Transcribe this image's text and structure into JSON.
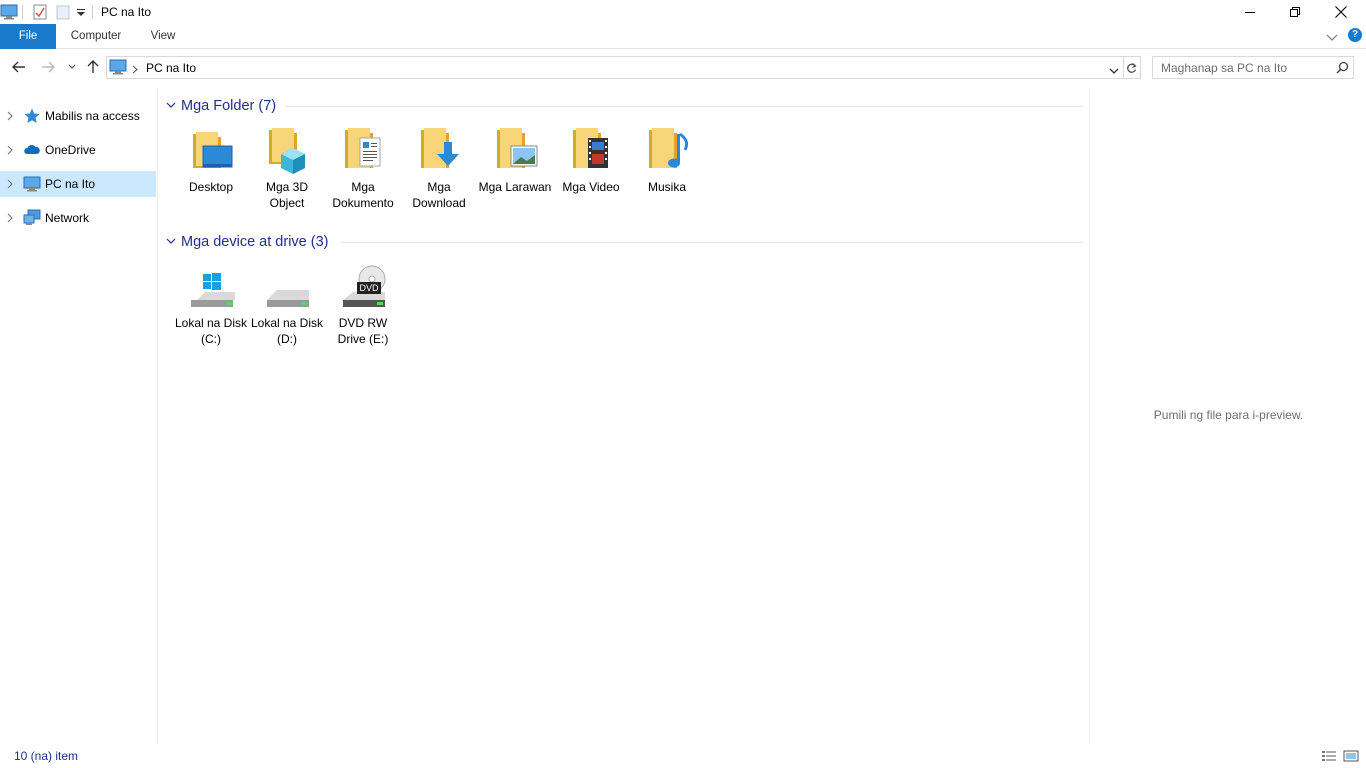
{
  "window": {
    "title": "PC na Ito"
  },
  "ribbon": {
    "tabs": [
      {
        "label": "File"
      },
      {
        "label": "Computer"
      },
      {
        "label": "View"
      }
    ]
  },
  "address": {
    "path": "PC na Ito",
    "search_placeholder": "Maghanap sa PC na Ito"
  },
  "navpane": {
    "items": [
      {
        "label": "Mabilis na access",
        "icon": "star-icon"
      },
      {
        "label": "OneDrive",
        "icon": "cloud-icon"
      },
      {
        "label": "PC na Ito",
        "icon": "computer-icon",
        "selected": true
      },
      {
        "label": "Network",
        "icon": "network-icon"
      }
    ]
  },
  "groups": {
    "folders": {
      "title": "Mga Folder (7)",
      "items": [
        {
          "label": "Desktop",
          "icon": "desktop-folder-icon"
        },
        {
          "label": "Mga 3D Object",
          "icon": "3d-objects-folder-icon"
        },
        {
          "label": "Mga Dokumento",
          "icon": "documents-folder-icon"
        },
        {
          "label": "Mga Download",
          "icon": "downloads-folder-icon"
        },
        {
          "label": "Mga Larawan",
          "icon": "pictures-folder-icon"
        },
        {
          "label": "Mga Video",
          "icon": "videos-folder-icon"
        },
        {
          "label": "Musika",
          "icon": "music-folder-icon"
        }
      ]
    },
    "devices": {
      "title": "Mga device at drive (3)",
      "items": [
        {
          "label": "Lokal na Disk (C:)",
          "icon": "windows-drive-icon"
        },
        {
          "label": "Lokal na Disk (D:)",
          "icon": "hard-drive-icon"
        },
        {
          "label": "DVD RW Drive (E:)",
          "icon": "dvd-drive-icon",
          "badge": "DVD"
        }
      ]
    }
  },
  "preview": {
    "message": "Pumili ng file para i-preview."
  },
  "status": {
    "item_count": "10 (na) item"
  },
  "colors": {
    "accent": "#1979ca",
    "selection": "#cce8ff",
    "group_header": "#1e3287",
    "folder_yellow": "#f7c948"
  }
}
